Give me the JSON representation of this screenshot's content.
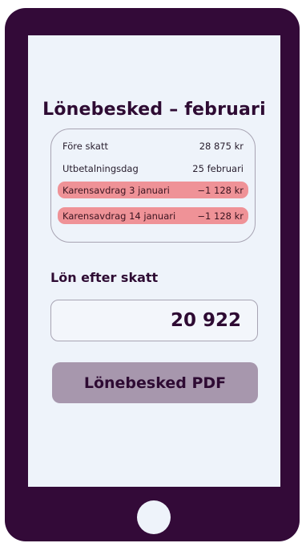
{
  "screen": {
    "title": "Lönebesked – februari"
  },
  "summary": {
    "rows": [
      {
        "label": "Före skatt",
        "value": "28 875 kr"
      },
      {
        "label": "Utbetalningsdag",
        "value": "25 februari"
      }
    ],
    "deductions": [
      {
        "label": "Karensavdrag 3 januari",
        "value": "−1 128 kr"
      },
      {
        "label": "Karensavdrag 14 januari",
        "value": "−1 128 kr"
      }
    ]
  },
  "net_pay": {
    "label": "Lön efter skatt",
    "value": "20 922"
  },
  "actions": {
    "pdf_label": "Lönebesked PDF"
  },
  "colors": {
    "device": "#330a38",
    "screen_bg": "#eef3fa",
    "deduction_highlight": "#ef9297",
    "button_bg": "#a797ad",
    "text_primary": "#2e0b33"
  }
}
